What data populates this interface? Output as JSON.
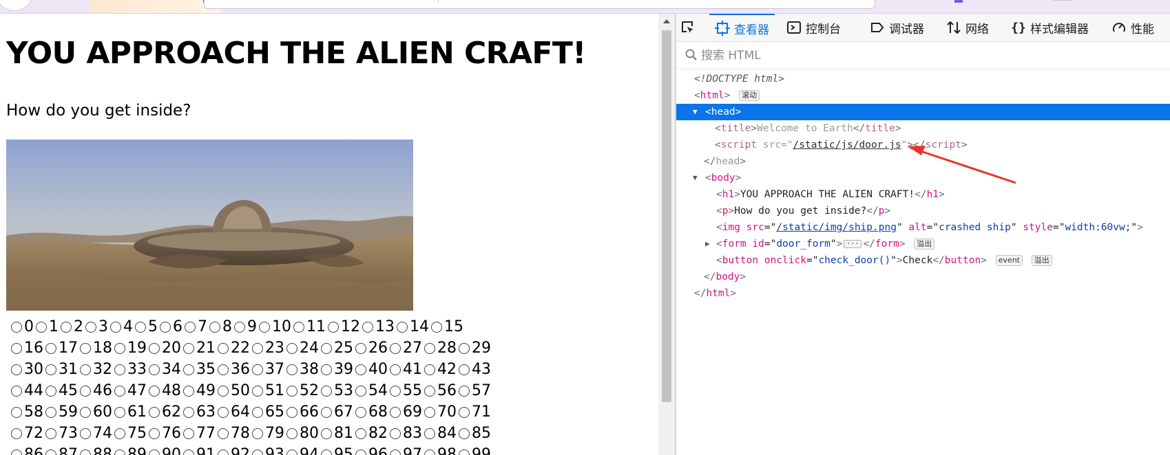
{
  "page": {
    "title": "YOU APPROACH THE ALIEN CRAFT!",
    "question": "How do you get inside?",
    "image_alt": "crashed ship",
    "radio_count": 100,
    "radios_per_row": 14,
    "first_row_count": 16
  },
  "devtools": {
    "tabs": [
      {
        "label": "查看器",
        "icon": "inspector-icon",
        "active": true
      },
      {
        "label": "控制台",
        "icon": "console-icon"
      },
      {
        "label": "调试器",
        "icon": "debugger-icon"
      },
      {
        "label": "网络",
        "icon": "network-icon"
      },
      {
        "label": "样式编辑器",
        "icon": "style-editor-icon"
      },
      {
        "label": "性能",
        "icon": "performance-icon"
      }
    ],
    "search_placeholder": "搜索 HTML",
    "badges": {
      "scroll": "滚动",
      "overflow": "溢出",
      "event": "event"
    },
    "tree": {
      "doctype": "<!DOCTYPE html>",
      "html_open": "html",
      "head": "head",
      "title_tag": "title",
      "title_text": "Welcome to Earth",
      "script_tag": "script",
      "script_src_attr": "src",
      "script_src": "/static/js/door.js",
      "body": "body",
      "h1_tag": "h1",
      "h1_text": "YOU APPROACH THE ALIEN CRAFT!",
      "p_tag": "p",
      "p_text": "How do you get inside?",
      "img_tag": "img",
      "img_src": "/static/img/ship.png",
      "img_alt": "crashed ship",
      "img_style": "width:60vw;",
      "form_tag": "form",
      "form_id": "door_form",
      "button_tag": "button",
      "button_onclick": "check_door()",
      "button_text": "Check"
    }
  }
}
